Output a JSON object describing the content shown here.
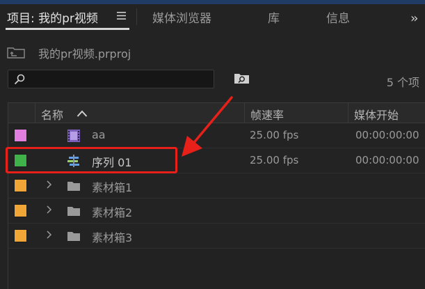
{
  "tabs": {
    "project": "项目: 我的pr视频",
    "media_browser": "媒体浏览器",
    "library": "库",
    "info": "信息"
  },
  "project": {
    "filename": "我的pr视频.prproj"
  },
  "search": {
    "value": "",
    "item_count": "5 个项"
  },
  "table": {
    "columns": {
      "name": "名称",
      "frame_rate": "帧速率",
      "media_start": "媒体开始"
    },
    "rows": [
      {
        "name": "aa",
        "fps": "25.00 fps",
        "start": "00:00:00:00",
        "color": "#e07fe0",
        "type": "clip"
      },
      {
        "name": "序列 01",
        "fps": "25.00 fps",
        "start": "00:00:00:00",
        "color": "#3fb24a",
        "type": "sequence"
      },
      {
        "name": "素材箱1",
        "fps": "",
        "start": "",
        "color": "#f0a637",
        "type": "bin"
      },
      {
        "name": "素材箱2",
        "fps": "",
        "start": "",
        "color": "#f0a637",
        "type": "bin"
      },
      {
        "name": "素材箱3",
        "fps": "",
        "start": "",
        "color": "#f0a637",
        "type": "bin"
      }
    ]
  },
  "colors": {
    "background": "#232323",
    "active_tab_underline": "#d6d6d6",
    "annotation": "#e8201a",
    "top_accent": "#1f3b66"
  },
  "icons": {
    "panel_menu": "hamburger-menu-icon",
    "more": "double-chevron-right-icon",
    "project": "project-folder-icon",
    "search": "search-icon",
    "new_bin": "new-bin-icon",
    "sort": "sort-ascending-icon",
    "clip": "film-clip-icon",
    "sequence": "sequence-icon",
    "bin": "folder-icon",
    "expand": "chevron-right-icon"
  }
}
